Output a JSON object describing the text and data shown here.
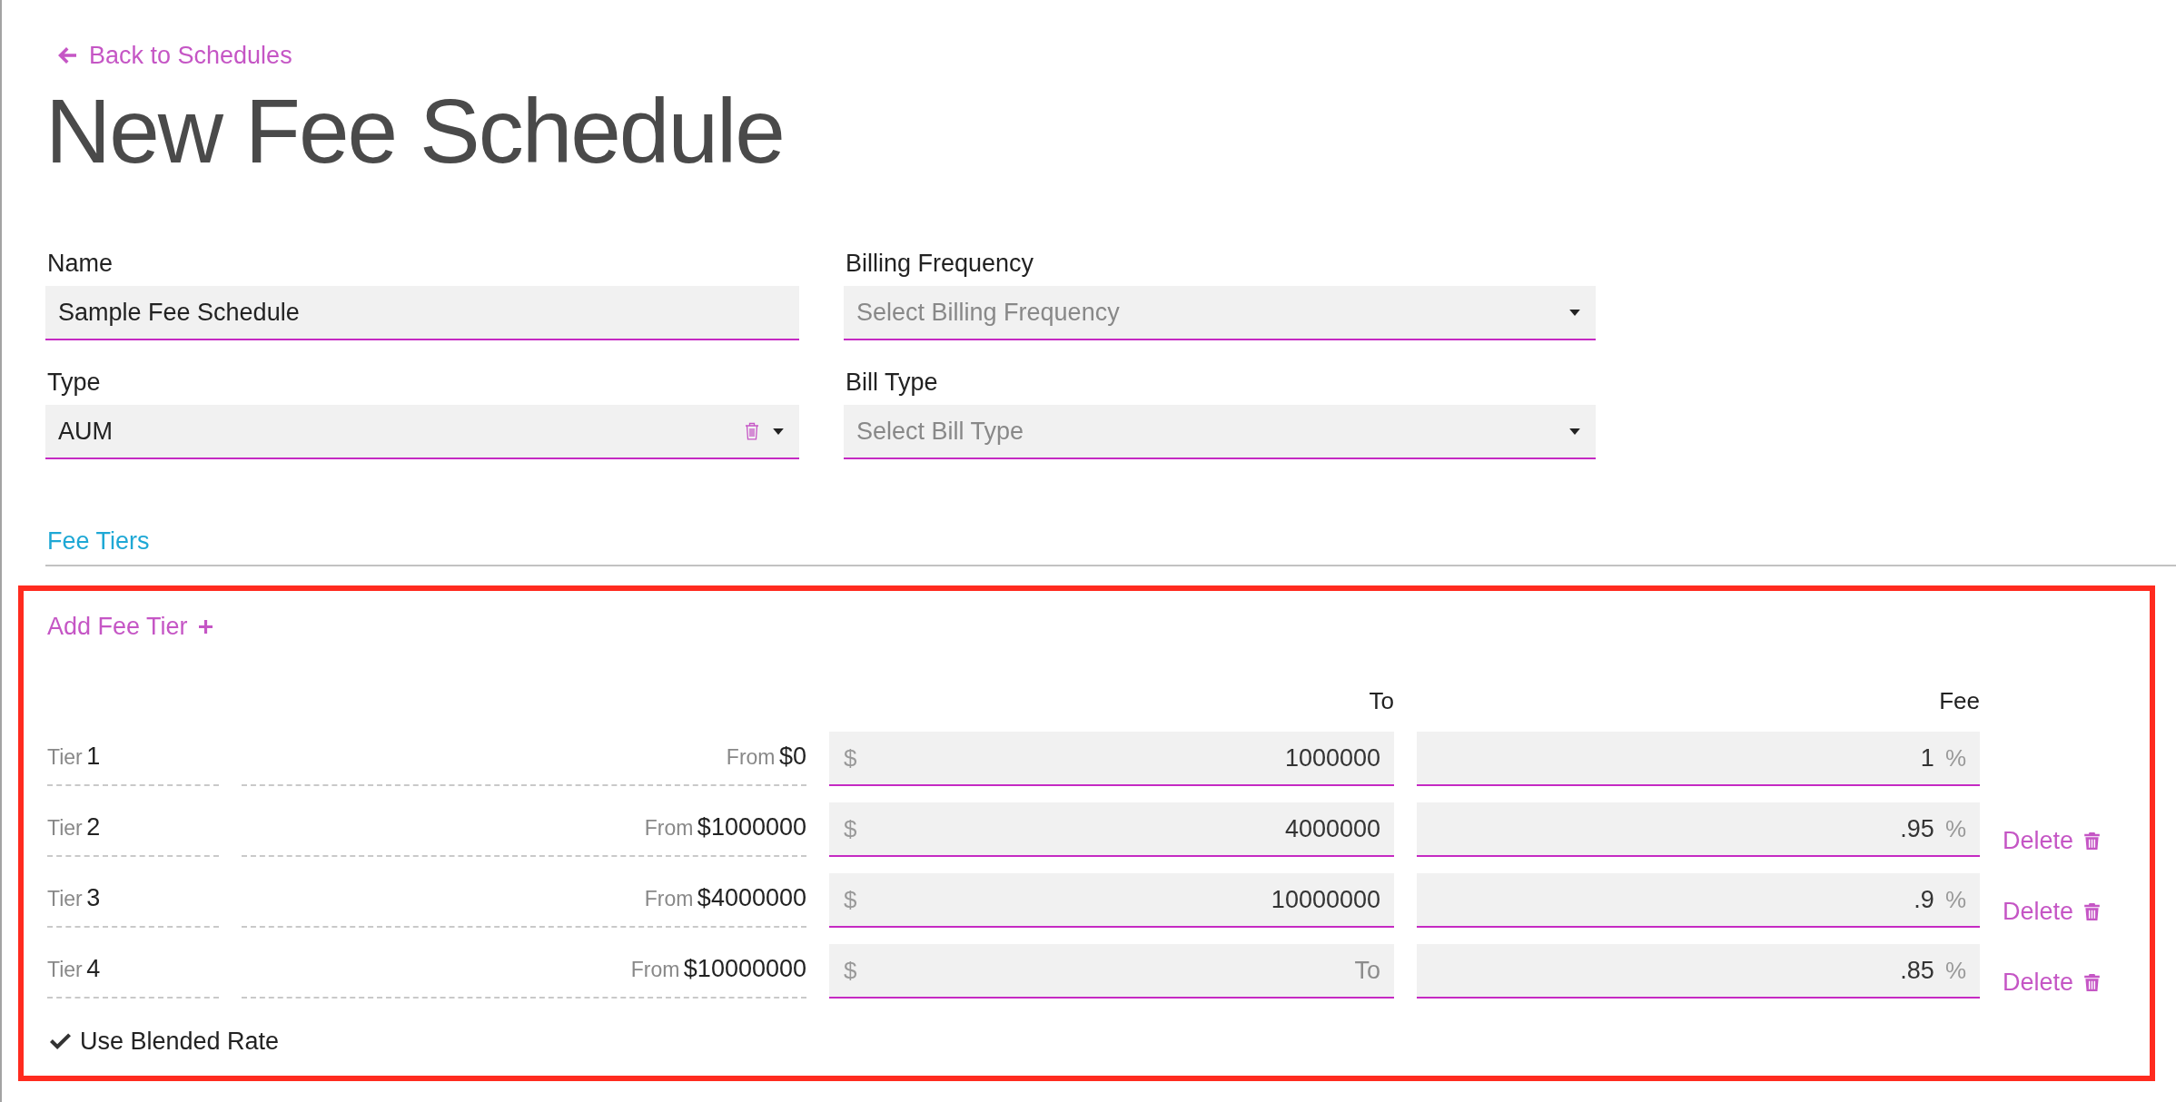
{
  "back_link": {
    "label": "Back to Schedules"
  },
  "title": "New Fee Schedule",
  "form": {
    "fields": [
      {
        "label": "Name",
        "kind": "text",
        "value": "Sample Fee Schedule",
        "clearable": false
      },
      {
        "label": "Billing Frequency",
        "kind": "select",
        "placeholder": "Select Billing Frequency",
        "clearable": false
      },
      {
        "label": "Type",
        "kind": "select",
        "value": "AUM",
        "clearable": true
      },
      {
        "label": "Bill Type",
        "kind": "select",
        "placeholder": "Select Bill Type",
        "clearable": false
      }
    ]
  },
  "tabs": [
    {
      "label": "Fee Tiers",
      "selected": true
    }
  ],
  "fee_tiers": {
    "add_label": "Add Fee Tier",
    "column_headers": {
      "to": "To",
      "fee": "Fee"
    },
    "rows": [
      {
        "tier_prefix": "Tier",
        "tier": "1",
        "from_prefix": "From",
        "from": "$0",
        "to_prefix": "$",
        "to": "1000000",
        "fee": "1",
        "fee_suffix": "%"
      },
      {
        "tier_prefix": "Tier",
        "tier": "2",
        "from_prefix": "From",
        "from": "$1000000",
        "to_prefix": "$",
        "to": "4000000",
        "fee": ".95",
        "fee_suffix": "%",
        "delete_label": "Delete"
      },
      {
        "tier_prefix": "Tier",
        "tier": "3",
        "from_prefix": "From",
        "from": "$4000000",
        "to_prefix": "$",
        "to": "10000000",
        "fee": ".9",
        "fee_suffix": "%",
        "delete_label": "Delete"
      },
      {
        "tier_prefix": "Tier",
        "tier": "4",
        "from_prefix": "From",
        "from": "$10000000",
        "to_prefix": "$",
        "to_placeholder": "To",
        "fee": ".85",
        "fee_suffix": "%",
        "delete_label": "Delete"
      }
    ],
    "blended_rate": {
      "label": "Use Blended Rate",
      "checked": true
    }
  }
}
